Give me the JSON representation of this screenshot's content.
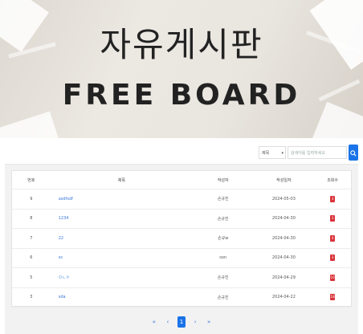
{
  "hero": {
    "title": "자유게시판",
    "subtitle": "FREE BOARD"
  },
  "search": {
    "select_value": "제목",
    "placeholder": "검색어를 입력하세요",
    "button_icon": "search-icon"
  },
  "table": {
    "headers": [
      "번호",
      "제목",
      "작성자",
      "작성일자",
      "조회수"
    ],
    "rows": [
      {
        "no": "9",
        "title": "asdfsdf",
        "author": "손규진",
        "date": "2024-05-03",
        "views": "3"
      },
      {
        "no": "8",
        "title": "1234",
        "author": "손규진",
        "date": "2024-04-30",
        "views": "3"
      },
      {
        "no": "7",
        "title": "22",
        "author": "손규w",
        "date": "2024-04-30",
        "views": "4"
      },
      {
        "no": "6",
        "title": "ss",
        "author": "son",
        "date": "2024-04-30",
        "views": "3"
      },
      {
        "no": "5",
        "title": "ㅁㄴㅇ",
        "author": "손규진",
        "date": "2024-04-29",
        "views": "10"
      },
      {
        "no": "3",
        "title": "sda",
        "author": "손규진",
        "date": "2024-04-22",
        "views": "18"
      }
    ]
  },
  "pagination": {
    "first": "«",
    "prev": "‹",
    "current": "1",
    "next": "›",
    "last": "»"
  },
  "colors": {
    "accent": "#1a73e8",
    "views_badge": "#d9343a",
    "link": "#3b78d8"
  }
}
